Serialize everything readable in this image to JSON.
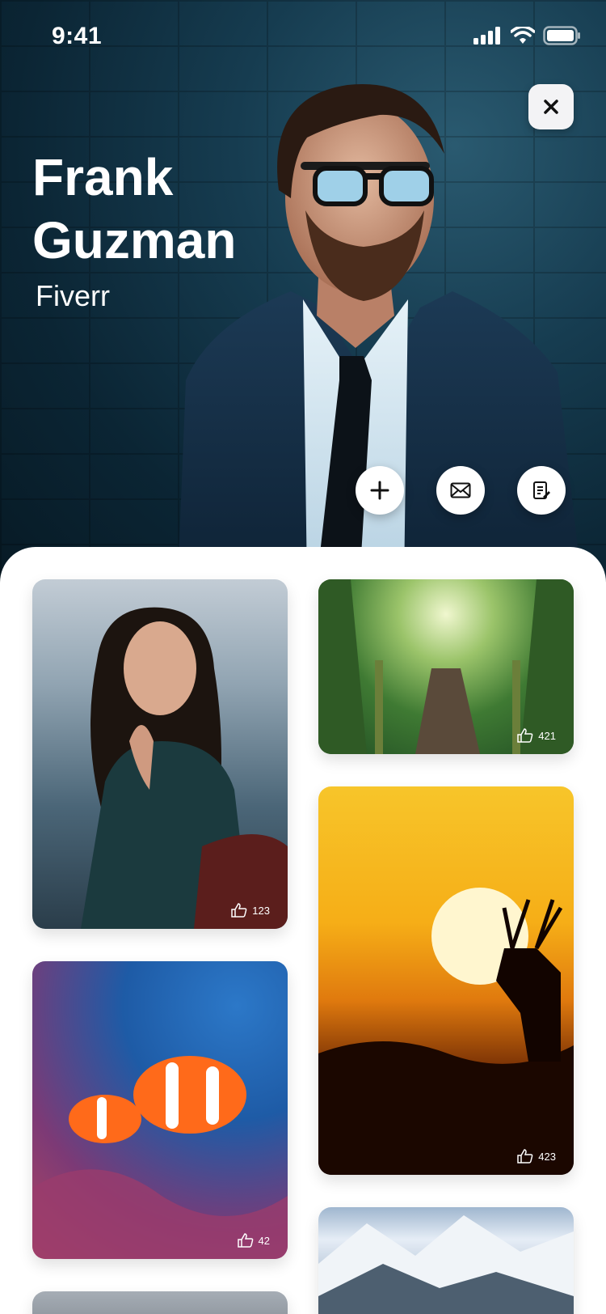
{
  "status": {
    "time": "9:41"
  },
  "profile": {
    "name": "Frank Guzman",
    "company": "Fiverr"
  },
  "actions": {
    "add_icon": "plus-icon",
    "message_icon": "mail-icon",
    "note_icon": "note-icon",
    "close_icon": "close-icon"
  },
  "gallery": {
    "items": [
      {
        "subject": "woman-portrait",
        "likes": "123"
      },
      {
        "subject": "forest-path",
        "likes": "421"
      },
      {
        "subject": "deer-sunset",
        "likes": "423"
      },
      {
        "subject": "clownfish",
        "likes": "42"
      },
      {
        "subject": "mountains",
        "likes": ""
      },
      {
        "subject": "building",
        "likes": ""
      }
    ]
  },
  "colors": {
    "hero_dark": "#0b2534",
    "accent_white": "#ffffff"
  }
}
